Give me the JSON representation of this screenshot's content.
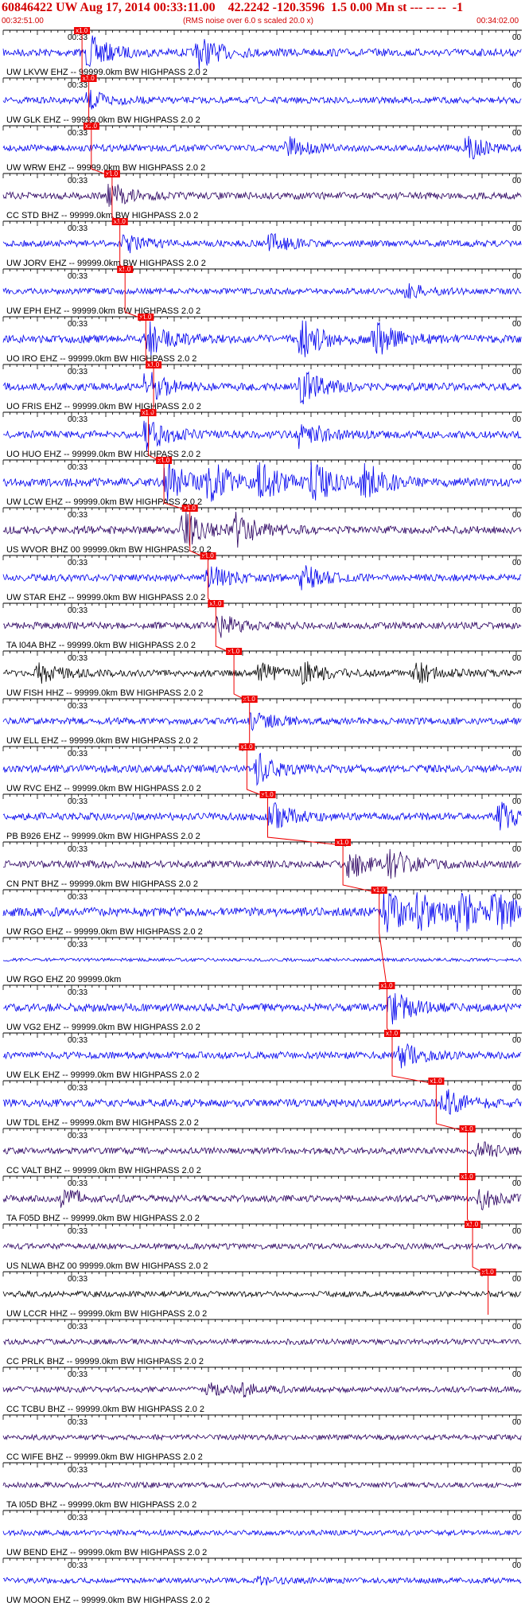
{
  "header": {
    "title": "60846422 UW Aug 17, 2014 00:33:11.00    42.2242 -120.3596  1.5 0.00 Mn st --- -- --  -1",
    "start_time": "00:32:51.00",
    "rms_note": "(RMS noise over 6.0 s scaled 20.0 x)",
    "end_time": "00:34:02.00"
  },
  "colors": {
    "trace_blue": "#0000ee",
    "trace_purple": "#2a0060",
    "trace_black": "#000000",
    "pick_red": "#ee0000",
    "header_red": "#d20000"
  },
  "tick_label": "00:33",
  "right_label": "00",
  "pick_label": "x1.0",
  "traces": [
    {
      "label": "UW LKVW EHZ -- 99999.0km BW  HIGHPASS  2.0  2",
      "color": "blue",
      "pick": 0.152,
      "burst": [
        0.17,
        0.38
      ],
      "amp": 0.9
    },
    {
      "label": "UW GLK EHZ -- 99999.0km BW  HIGHPASS  2.0  2",
      "color": "blue",
      "pick": 0.165,
      "burst": [
        0.17
      ],
      "amp": 0.5
    },
    {
      "label": "UW WRW EHZ -- 99999.0km BW  HIGHPASS  2.0  2",
      "color": "blue",
      "pick": 0.17,
      "burst": [
        0.55,
        0.9
      ],
      "amp": 0.6
    },
    {
      "label": "CC STD BHZ -- 99999.0km BW  HIGHPASS  2.0  2",
      "color": "purple",
      "pick": 0.21,
      "burst": [
        0.21
      ],
      "amp": 0.7
    },
    {
      "label": "UW JORV EHZ -- 99999.0km BW  HIGHPASS  2.0  2",
      "color": "blue",
      "pick": 0.225,
      "burst": [
        0.24,
        0.52
      ],
      "amp": 0.5
    },
    {
      "label": "UW EPH EHZ -- 99999.0km BW  HIGHPASS  2.0  2",
      "color": "blue",
      "pick": 0.235,
      "burst": [
        0.78
      ],
      "amp": 0.4
    },
    {
      "label": "UO IRO EHZ -- 99999.0km BW  HIGHPASS  2.0  2",
      "color": "blue",
      "pick": 0.275,
      "burst": [
        0.28,
        0.58,
        0.72
      ],
      "amp": 1.0
    },
    {
      "label": "UO FRIS EHZ -- 99999.0km BW  HIGHPASS  2.0  2",
      "color": "blue",
      "pick": 0.29,
      "burst": [
        0.28,
        0.58
      ],
      "amp": 0.9
    },
    {
      "label": "UO HUO EHZ -- 99999.0km BW  HIGHPASS  2.0  2",
      "color": "blue",
      "pick": 0.28,
      "burst": [
        0.28,
        0.58
      ],
      "amp": 0.9
    },
    {
      "label": "UW LCW EHZ -- 99999.0km BW  HIGHPASS  2.0  2",
      "color": "blue",
      "pick": 0.31,
      "burst": [
        0.32,
        0.4,
        0.5,
        0.6,
        0.7
      ],
      "amp": 1.2
    },
    {
      "label": "US WVOR BHZ 00 99999.0km BW  HIGHPASS  2.0  2",
      "color": "purple",
      "pick": 0.36,
      "burst": [
        0.35,
        0.45
      ],
      "amp": 1.0
    },
    {
      "label": "UW STAR EHZ -- 99999.0km BW  HIGHPASS  2.0  2",
      "color": "blue",
      "pick": 0.395,
      "burst": [
        0.4,
        0.58
      ],
      "amp": 0.7
    },
    {
      "label": "TA I04A BHZ -- 99999.0km BW  HIGHPASS  2.0  2",
      "color": "purple",
      "pick": 0.41,
      "burst": [
        0.42
      ],
      "amp": 0.6
    },
    {
      "label": "UW FISH HHZ -- 99999.0km BW  HIGHPASS  2.0  2",
      "color": "black",
      "pick": 0.445,
      "burst": [
        0.07,
        0.5,
        0.58,
        0.8
      ],
      "amp": 0.6
    },
    {
      "label": "UW ELL EHZ -- 99999.0km BW  HIGHPASS  2.0  2",
      "color": "blue",
      "pick": 0.475,
      "burst": [
        0.48
      ],
      "amp": 0.6
    },
    {
      "label": "UW RVC EHZ -- 99999.0km BW  HIGHPASS  2.0  2",
      "color": "blue",
      "pick": 0.47,
      "burst": [
        0.49
      ],
      "amp": 0.9
    },
    {
      "label": "PB B926 EHZ -- 99999.0km BW  HIGHPASS  2.0  2",
      "color": "blue",
      "pick": 0.51,
      "burst": [
        0.52,
        0.96
      ],
      "amp": 0.8
    },
    {
      "label": "CN PNT BHZ -- 99999.0km BW  HIGHPASS  2.0  2",
      "color": "purple",
      "pick": 0.655,
      "burst": [
        0.67,
        0.75
      ],
      "amp": 0.8
    },
    {
      "label": "UW RGO EHZ -- 99999.0km BW  HIGHPASS  2.0  2",
      "color": "blue",
      "pick": 0.725,
      "burst": [
        0.74,
        0.8,
        0.88,
        0.95
      ],
      "amp": 1.3
    },
    {
      "label": "UW RGO EHZ 20 99999.0km",
      "color": "blue",
      "pick": -1,
      "burst": [],
      "amp": 0.0
    },
    {
      "label": "UW VG2 EHZ -- 99999.0km BW  HIGHPASS  2.0  2",
      "color": "blue",
      "pick": 0.74,
      "burst": [
        0.75
      ],
      "amp": 1.0
    },
    {
      "label": "UW ELK EHZ -- 99999.0km BW  HIGHPASS  2.0  2",
      "color": "blue",
      "pick": 0.75,
      "burst": [
        0.77
      ],
      "amp": 0.7
    },
    {
      "label": "UW TDL EHZ -- 99999.0km BW  HIGHPASS  2.0  2",
      "color": "blue",
      "pick": 0.835,
      "burst": [
        0.85
      ],
      "amp": 0.9
    },
    {
      "label": "CC VALT BHZ -- 99999.0km BW  HIGHPASS  2.0  2",
      "color": "purple",
      "pick": 0.895,
      "burst": [
        0.92
      ],
      "amp": 0.5
    },
    {
      "label": "TA F05D BHZ -- 99999.0km BW  HIGHPASS  2.0  2",
      "color": "purple",
      "pick": 0.895,
      "burst": [
        0.12,
        0.92
      ],
      "amp": 0.6
    },
    {
      "label": "US NLWA BHZ 00 99999.0km BW  HIGHPASS  2.0  2",
      "color": "purple",
      "pick": 0.905,
      "burst": [],
      "amp": 0.3
    },
    {
      "label": "UW LCCR HHZ -- 99999.0km BW  HIGHPASS  2.0  2",
      "color": "black",
      "pick": 0.935,
      "burst": [],
      "amp": 0.3
    },
    {
      "label": "CC PRLK BHZ -- 99999.0km BW  HIGHPASS  2.0  2",
      "color": "purple",
      "pick": -1,
      "burst": [],
      "amp": 0.2
    },
    {
      "label": "CC TCBU BHZ -- 99999.0km BW  HIGHPASS  2.0  2",
      "color": "purple",
      "pick": -1,
      "burst": [
        0.4,
        0.46
      ],
      "amp": 0.3
    },
    {
      "label": "CC WIFE BHZ -- 99999.0km BW  HIGHPASS  2.0  2",
      "color": "purple",
      "pick": -1,
      "burst": [],
      "amp": 0.15
    },
    {
      "label": "TA I05D BHZ -- 99999.0km BW  HIGHPASS  2.0  2",
      "color": "purple",
      "pick": -1,
      "burst": [],
      "amp": 0.2
    },
    {
      "label": "UW BEND EHZ -- 99999.0km BW  HIGHPASS  2.0  2",
      "color": "blue",
      "pick": -1,
      "burst": [],
      "amp": 0.2
    },
    {
      "label": "UW MOON EHZ -- 99999.0km BW  HIGHPASS  2.0  2",
      "color": "blue",
      "pick": -1,
      "burst": [
        0.5
      ],
      "amp": 0.2
    }
  ]
}
